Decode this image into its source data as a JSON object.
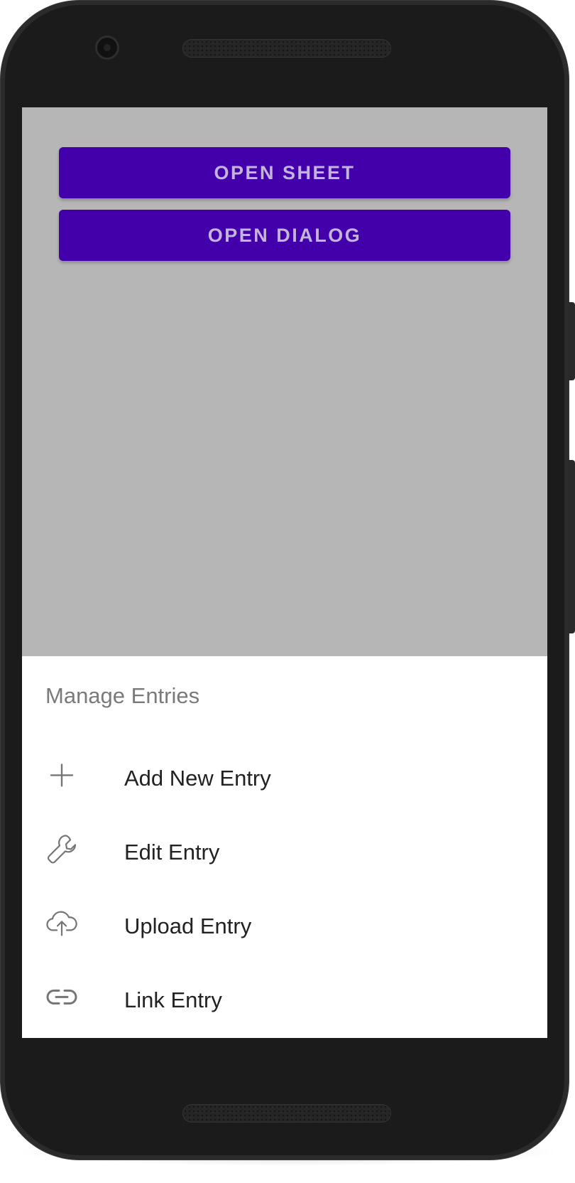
{
  "main": {
    "buttons": [
      {
        "label": "OPEN SHEET"
      },
      {
        "label": "OPEN DIALOG"
      }
    ]
  },
  "sheet": {
    "title": "Manage Entries",
    "items": [
      {
        "icon": "plus-icon",
        "label": "Add New Entry"
      },
      {
        "icon": "wrench-icon",
        "label": "Edit Entry"
      },
      {
        "icon": "cloud-upload-icon",
        "label": "Upload Entry"
      },
      {
        "icon": "link-icon",
        "label": "Link Entry"
      }
    ]
  },
  "colors": {
    "primary": "#4300aa",
    "button_text": "#c3b5d9",
    "scrim": "#b6b6b6",
    "sheet_bg": "#ffffff",
    "title_text": "#7a7a7a",
    "item_text": "#222222",
    "icon": "#757575"
  }
}
